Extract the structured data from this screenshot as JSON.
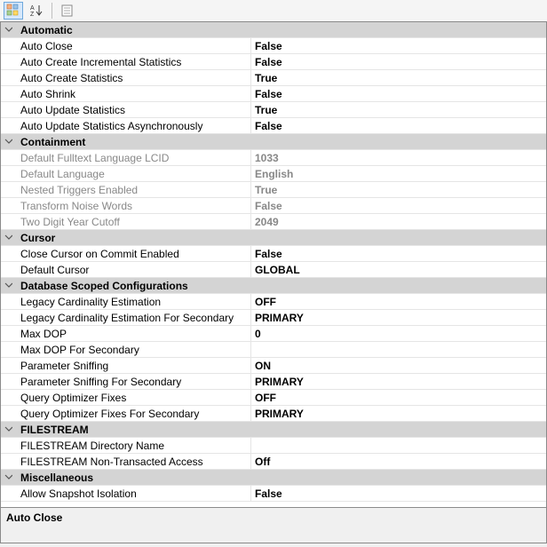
{
  "toolbar": {
    "categorized": "categorized-view",
    "alphabetical": "alphabetical-view",
    "propertypages": "property-pages"
  },
  "categories": [
    {
      "name": "Automatic",
      "expanded": true,
      "items": [
        {
          "label": "Auto Close",
          "value": "False",
          "readonly": false
        },
        {
          "label": "Auto Create Incremental Statistics",
          "value": "False",
          "readonly": false
        },
        {
          "label": "Auto Create Statistics",
          "value": "True",
          "readonly": false
        },
        {
          "label": "Auto Shrink",
          "value": "False",
          "readonly": false
        },
        {
          "label": "Auto Update Statistics",
          "value": "True",
          "readonly": false
        },
        {
          "label": "Auto Update Statistics Asynchronously",
          "value": "False",
          "readonly": false
        }
      ]
    },
    {
      "name": "Containment",
      "expanded": true,
      "items": [
        {
          "label": "Default Fulltext Language LCID",
          "value": "1033",
          "readonly": true
        },
        {
          "label": "Default Language",
          "value": "English",
          "readonly": true
        },
        {
          "label": "Nested Triggers Enabled",
          "value": "True",
          "readonly": true
        },
        {
          "label": "Transform Noise Words",
          "value": "False",
          "readonly": true
        },
        {
          "label": "Two Digit Year Cutoff",
          "value": "2049",
          "readonly": true
        }
      ]
    },
    {
      "name": "Cursor",
      "expanded": true,
      "items": [
        {
          "label": "Close Cursor on Commit Enabled",
          "value": "False",
          "readonly": false
        },
        {
          "label": "Default Cursor",
          "value": "GLOBAL",
          "readonly": false
        }
      ]
    },
    {
      "name": "Database Scoped Configurations",
      "expanded": true,
      "items": [
        {
          "label": "Legacy Cardinality Estimation",
          "value": "OFF",
          "readonly": false
        },
        {
          "label": "Legacy Cardinality Estimation For Secondary",
          "value": "PRIMARY",
          "readonly": false
        },
        {
          "label": "Max DOP",
          "value": "0",
          "readonly": false
        },
        {
          "label": "Max DOP For Secondary",
          "value": "",
          "readonly": false
        },
        {
          "label": "Parameter Sniffing",
          "value": "ON",
          "readonly": false
        },
        {
          "label": "Parameter Sniffing For Secondary",
          "value": "PRIMARY",
          "readonly": false
        },
        {
          "label": "Query Optimizer Fixes",
          "value": "OFF",
          "readonly": false
        },
        {
          "label": "Query Optimizer Fixes For Secondary",
          "value": "PRIMARY",
          "readonly": false
        }
      ]
    },
    {
      "name": "FILESTREAM",
      "expanded": true,
      "items": [
        {
          "label": "FILESTREAM Directory Name",
          "value": "",
          "readonly": false
        },
        {
          "label": "FILESTREAM Non-Transacted Access",
          "value": "Off",
          "readonly": false
        }
      ]
    },
    {
      "name": "Miscellaneous",
      "expanded": true,
      "items": [
        {
          "label": "Allow Snapshot Isolation",
          "value": "False",
          "readonly": false
        }
      ]
    }
  ],
  "description": {
    "title": "Auto Close"
  }
}
